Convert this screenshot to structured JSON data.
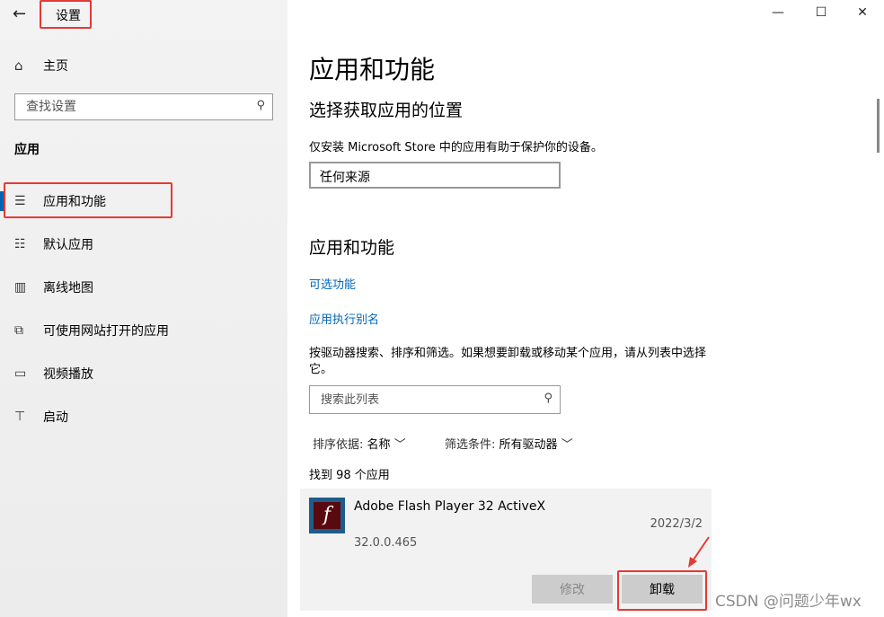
{
  "titlebar": {
    "back_icon": "back-arrow-icon",
    "title": "设置",
    "controls": {
      "minimize": "—",
      "maximize": "☐",
      "close": "✕"
    }
  },
  "sidebar": {
    "home_label": "主页",
    "search_placeholder": "查找设置",
    "category": "应用",
    "items": [
      {
        "label": "应用和功能",
        "icon": "list-icon",
        "active": true
      },
      {
        "label": "默认应用",
        "icon": "default-apps-icon"
      },
      {
        "label": "离线地图",
        "icon": "map-icon"
      },
      {
        "label": "可使用网站打开的应用",
        "icon": "open-with-icon"
      },
      {
        "label": "视频播放",
        "icon": "video-icon"
      },
      {
        "label": "启动",
        "icon": "startup-icon"
      }
    ]
  },
  "main": {
    "title": "应用和功能",
    "choose_location_heading": "选择获取应用的位置",
    "location_desc": "仅安装 Microsoft Store 中的应用有助于保护你的设备。",
    "location_value": "任何来源",
    "apps_heading": "应用和功能",
    "link_optional": "可选功能",
    "link_alias": "应用执行别名",
    "filter_desc": "按驱动器搜索、排序和筛选。如果想要卸载或移动某个应用，请从列表中选择它。",
    "list_search_placeholder": "搜索此列表",
    "sort_label": "排序依据:",
    "sort_value": "名称",
    "filter_label": "筛选条件:",
    "filter_value": "所有驱动器",
    "count_text": "找到 98 个应用",
    "app": {
      "name": "Adobe Flash Player 32 ActiveX",
      "date": "2022/3/2",
      "version": "32.0.0.465",
      "modify_label": "修改",
      "uninstall_label": "卸载"
    }
  },
  "watermark": "CSDN @问题少年wx",
  "accent_color": "#0063b1",
  "highlight_color": "#e53935"
}
